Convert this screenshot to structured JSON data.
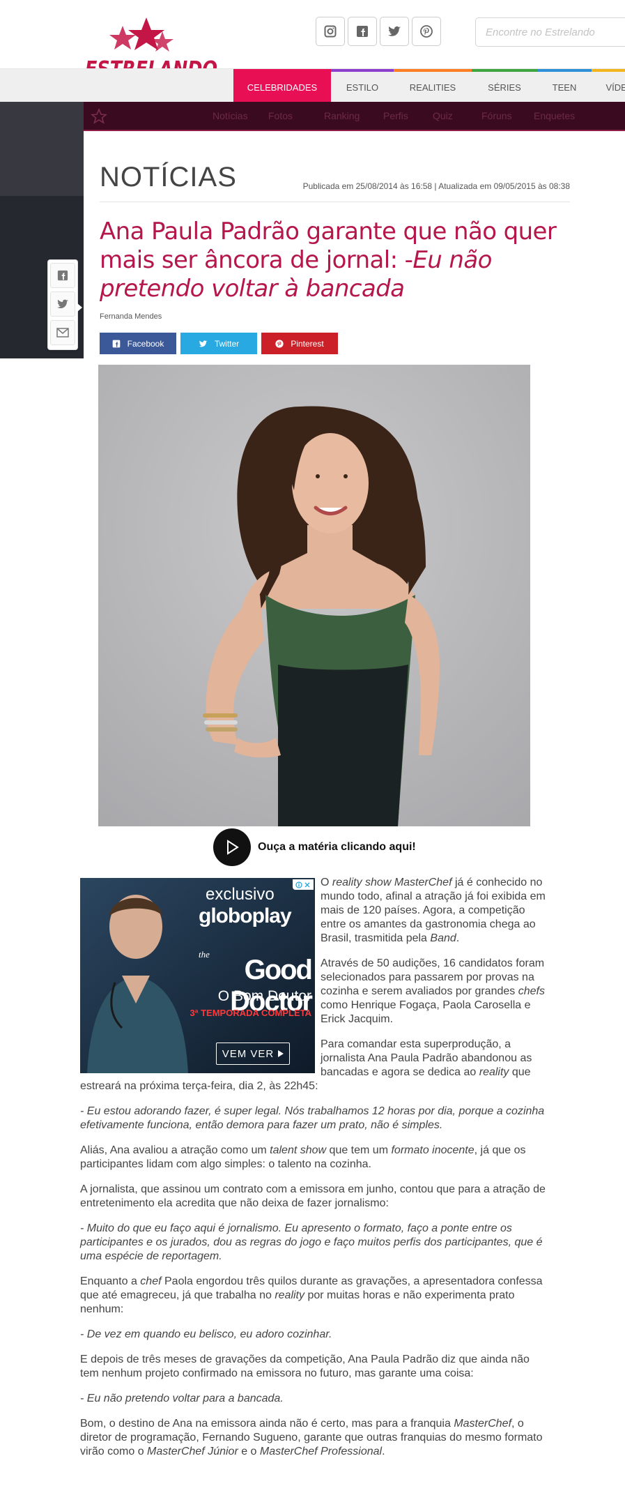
{
  "header": {
    "logo_text": "ESTRELANDO",
    "search_placeholder": "Encontre no Estrelando",
    "social_icons": [
      "instagram-icon",
      "facebook-icon",
      "twitter-icon",
      "pinterest-icon"
    ]
  },
  "nav": {
    "tabs": [
      {
        "label": "CELEBRIDADES",
        "color": "#e90f54",
        "active": true
      },
      {
        "label": "ESTILO",
        "color": "#8c3fcf",
        "active": false
      },
      {
        "label": "REALITIES",
        "color": "#ff7d23",
        "active": false
      },
      {
        "label": "SÉRIES",
        "color": "#3da53f",
        "active": false
      },
      {
        "label": "TEEN",
        "color": "#2d8fd5",
        "active": false
      },
      {
        "label": "VÍDEOS",
        "color": "#f3b51c",
        "active": false
      }
    ],
    "subnav": [
      "Notícias",
      "Fotos",
      "Ranking",
      "Perfis",
      "Quiz",
      "Fóruns",
      "Enquetes"
    ]
  },
  "article": {
    "section": "NOTÍCIAS",
    "pubdate": "Publicada em 25/08/2014 às 16:58 | Atualizada em 09/05/2015 às 08:38",
    "headline_main": "Ana Paula Padrão garante que não quer mais ser âncora de jornal: -",
    "headline_quote": "Eu não pretendo voltar à bancada",
    "author": "Fernanda Mendes",
    "share": {
      "facebook": "Facebook",
      "twitter": "Twitter",
      "pinterest": "Pinterest"
    },
    "audio_label": "Ouça a matéria clicando aqui!"
  },
  "ad": {
    "exclusivo": "exclusivo",
    "brand": "globoplay",
    "the": "the",
    "title": "Good Doctor",
    "subtitle": "O Bom Doutor",
    "season": "3ª TEMPORADA COMPLETA",
    "cta": "VEM VER"
  },
  "body": {
    "p1": [
      "O ",
      "reality show MasterChef",
      " já é conhecido no mundo todo, afinal a atração já foi exibida em mais de 120 países. Agora, a competição entre os amantes da gastronomia chega ao Brasil, trasmitida pela ",
      "Band",
      "."
    ],
    "p2": [
      "Através de 50 audições, 16 candidatos foram selecionados para passarem por provas na cozinha e serem avaliados por grandes ",
      "chefs",
      " como Henrique Fogaça, Paola Carosella e Erick Jacquim."
    ],
    "p3": [
      "Para comandar esta superprodução, a jornalista Ana Paula Padrão abandonou as bancadas e agora se dedica ao ",
      "reality",
      " que estreará na próxima terça-feira, dia 2, às 22h45:"
    ],
    "q1": "- Eu estou adorando fazer, é super legal. Nós trabalhamos 12 horas por dia, porque a cozinha efetivamente funciona, então demora para fazer um prato, não é simples.",
    "p4": [
      "Aliás, Ana avaliou a atração como um ",
      "talent show",
      " que tem um ",
      "formato inocente",
      ", já que os participantes lidam com algo simples: o talento na cozinha."
    ],
    "p5": "A jornalista, que assinou um contrato com a emissora em junho, contou que para a atração de entretenimento ela acredita que não deixa de fazer jornalismo:",
    "q2": "- Muito do que eu faço aqui é jornalismo. Eu apresento o formato, faço a ponte entre os participantes e os jurados, dou as regras do jogo e faço muitos perfis dos participantes, que é uma espécie de reportagem.",
    "p6": [
      "Enquanto a ",
      "chef",
      " Paola engordou três quilos durante as gravações, a apresentadora  confessa que até emagreceu, já que trabalha no ",
      "reality",
      " por muitas horas e não experimenta prato nenhum:"
    ],
    "q3": "- De vez em quando eu belisco, eu adoro cozinhar.",
    "p7": "E depois de três meses de gravações da competição, Ana Paula Padrão diz que ainda não tem nenhum projeto confirmado na emissora no futuro, mas garante uma coisa:",
    "q4": "- Eu não pretendo voltar para a bancada.",
    "p8": [
      "Bom, o destino de Ana na emissora ainda não é certo, mas para a franquia ",
      "MasterChef",
      ", o diretor de programação, Fernando Sugueno, garante que outras franquias do mesmo formato virão como o ",
      "MasterChef Júnior",
      " e o ",
      "MasterChef Professional",
      "."
    ]
  }
}
